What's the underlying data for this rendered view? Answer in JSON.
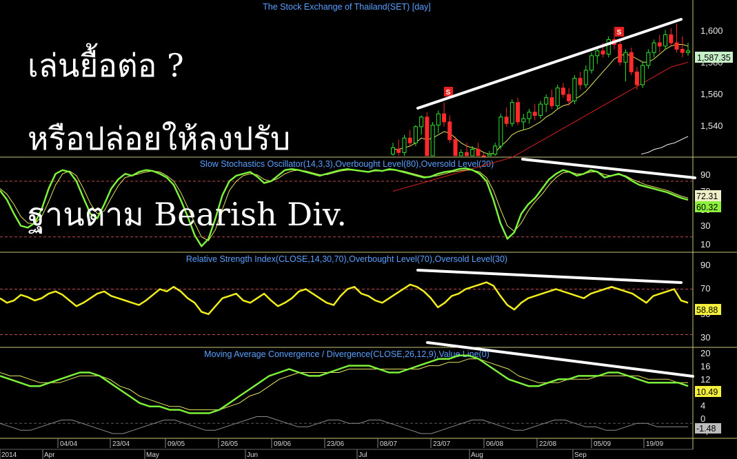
{
  "overlay": {
    "line1": "เล่นยื้อต่อ ?",
    "line2": "หรือปล่อยให้ลงปรับ",
    "line3": "ฐานตาม Bearish Div."
  },
  "colors": {
    "background": "#000000",
    "title": "#5aa0ff",
    "stoch_main": "#7df23a",
    "stoch_signal": "#e8e860",
    "rsi": "#f2ee1c",
    "macd": "#7df23a",
    "macd_signal": "#e8e860",
    "value_line": "#8c8c8c",
    "bull_candle": "#2ee82e",
    "bear_candle": "#ff2a2a",
    "ma_fast": "#e8e860",
    "ma_slow": "#e02020",
    "trendline": "#ffffff",
    "ref_line": "#c24a4a",
    "frame": "#c8c878"
  },
  "chart_data": [
    {
      "type": "candlestick",
      "title": "The Stock Exchange of Thailand(SET) [day]",
      "ylim": [
        1522,
        1610
      ],
      "yticks": [
        "1,600",
        "1,580",
        "1,560",
        "1,540"
      ],
      "last_value_label": "1,587.35",
      "signal_markers": [
        {
          "label": "S",
          "near": "2014-07-22"
        },
        {
          "label": "S",
          "near": "2014-09-08"
        }
      ],
      "candles": [
        {
          "o": 1523,
          "h": 1530,
          "l": 1520,
          "c": 1527
        },
        {
          "o": 1526,
          "h": 1532,
          "l": 1522,
          "c": 1524
        },
        {
          "o": 1524,
          "h": 1535,
          "l": 1522,
          "c": 1533
        },
        {
          "o": 1533,
          "h": 1538,
          "l": 1528,
          "c": 1530
        },
        {
          "o": 1530,
          "h": 1541,
          "l": 1528,
          "c": 1540
        },
        {
          "o": 1540,
          "h": 1547,
          "l": 1535,
          "c": 1546
        },
        {
          "o": 1546,
          "h": 1549,
          "l": 1520,
          "c": 1521
        },
        {
          "o": 1522,
          "h": 1543,
          "l": 1520,
          "c": 1541
        },
        {
          "o": 1541,
          "h": 1550,
          "l": 1536,
          "c": 1548
        },
        {
          "o": 1548,
          "h": 1555,
          "l": 1540,
          "c": 1543
        },
        {
          "o": 1543,
          "h": 1547,
          "l": 1530,
          "c": 1532
        },
        {
          "o": 1532,
          "h": 1534,
          "l": 1518,
          "c": 1520
        },
        {
          "o": 1520,
          "h": 1526,
          "l": 1515,
          "c": 1524
        },
        {
          "o": 1524,
          "h": 1530,
          "l": 1518,
          "c": 1521
        },
        {
          "o": 1521,
          "h": 1528,
          "l": 1517,
          "c": 1526
        },
        {
          "o": 1526,
          "h": 1530,
          "l": 1520,
          "c": 1522
        },
        {
          "o": 1522,
          "h": 1524,
          "l": 1514,
          "c": 1516
        },
        {
          "o": 1516,
          "h": 1525,
          "l": 1512,
          "c": 1523
        },
        {
          "o": 1523,
          "h": 1530,
          "l": 1518,
          "c": 1528
        },
        {
          "o": 1528,
          "h": 1548,
          "l": 1526,
          "c": 1546
        },
        {
          "o": 1546,
          "h": 1552,
          "l": 1540,
          "c": 1542
        },
        {
          "o": 1542,
          "h": 1557,
          "l": 1540,
          "c": 1555
        },
        {
          "o": 1555,
          "h": 1558,
          "l": 1541,
          "c": 1543
        },
        {
          "o": 1543,
          "h": 1548,
          "l": 1538,
          "c": 1545
        },
        {
          "o": 1545,
          "h": 1551,
          "l": 1542,
          "c": 1549
        },
        {
          "o": 1549,
          "h": 1554,
          "l": 1544,
          "c": 1547
        },
        {
          "o": 1547,
          "h": 1556,
          "l": 1545,
          "c": 1554
        },
        {
          "o": 1554,
          "h": 1560,
          "l": 1549,
          "c": 1558
        },
        {
          "o": 1558,
          "h": 1563,
          "l": 1551,
          "c": 1553
        },
        {
          "o": 1553,
          "h": 1566,
          "l": 1551,
          "c": 1564
        },
        {
          "o": 1564,
          "h": 1567,
          "l": 1558,
          "c": 1560
        },
        {
          "o": 1560,
          "h": 1564,
          "l": 1553,
          "c": 1556
        },
        {
          "o": 1556,
          "h": 1572,
          "l": 1554,
          "c": 1570
        },
        {
          "o": 1570,
          "h": 1574,
          "l": 1563,
          "c": 1566
        },
        {
          "o": 1566,
          "h": 1578,
          "l": 1564,
          "c": 1575
        },
        {
          "o": 1575,
          "h": 1586,
          "l": 1573,
          "c": 1584
        },
        {
          "o": 1584,
          "h": 1590,
          "l": 1579,
          "c": 1587
        },
        {
          "o": 1587,
          "h": 1592,
          "l": 1583,
          "c": 1585
        },
        {
          "o": 1585,
          "h": 1596,
          "l": 1583,
          "c": 1594
        },
        {
          "o": 1594,
          "h": 1602,
          "l": 1588,
          "c": 1591
        },
        {
          "o": 1591,
          "h": 1594,
          "l": 1578,
          "c": 1580
        },
        {
          "o": 1580,
          "h": 1588,
          "l": 1568,
          "c": 1586
        },
        {
          "o": 1586,
          "h": 1589,
          "l": 1572,
          "c": 1574
        },
        {
          "o": 1574,
          "h": 1577,
          "l": 1563,
          "c": 1566
        },
        {
          "o": 1566,
          "h": 1580,
          "l": 1564,
          "c": 1578
        },
        {
          "o": 1578,
          "h": 1588,
          "l": 1576,
          "c": 1586
        },
        {
          "o": 1586,
          "h": 1594,
          "l": 1583,
          "c": 1592
        },
        {
          "o": 1592,
          "h": 1597,
          "l": 1586,
          "c": 1590
        },
        {
          "o": 1590,
          "h": 1600,
          "l": 1588,
          "c": 1597
        },
        {
          "o": 1597,
          "h": 1601,
          "l": 1590,
          "c": 1592
        },
        {
          "o": 1592,
          "h": 1604,
          "l": 1586,
          "c": 1588
        },
        {
          "o": 1588,
          "h": 1596,
          "l": 1583,
          "c": 1586
        },
        {
          "o": 1586,
          "h": 1592,
          "l": 1584,
          "c": 1587
        }
      ],
      "ma_fast": [
        1526,
        1526,
        1527,
        1528,
        1530,
        1533,
        1532,
        1533,
        1535,
        1537,
        1536,
        1533,
        1530,
        1528,
        1527,
        1526,
        1524,
        1523,
        1524,
        1528,
        1531,
        1535,
        1537,
        1538,
        1539,
        1541,
        1543,
        1546,
        1548,
        1551,
        1553,
        1554,
        1557,
        1559,
        1562,
        1566,
        1570,
        1574,
        1578,
        1582,
        1584,
        1585,
        1584,
        1582,
        1580,
        1580,
        1582,
        1585,
        1588,
        1590,
        1591,
        1591,
        1590
      ],
      "ma_slow": [
        1500,
        1501,
        1502,
        1503,
        1504,
        1505,
        1506,
        1507,
        1508,
        1509,
        1510,
        1511,
        1512,
        1513,
        1514,
        1515,
        1516,
        1517,
        1518,
        1519,
        1520,
        1521,
        1523,
        1525,
        1527,
        1529,
        1531,
        1533,
        1535,
        1537,
        1539,
        1541,
        1543,
        1545,
        1547,
        1549,
        1551,
        1553,
        1555,
        1557,
        1559,
        1561,
        1563,
        1565,
        1567,
        1569,
        1571,
        1573,
        1575,
        1577,
        1578,
        1579,
        1580
      ],
      "long_ma": [
        1523,
        1524,
        1526,
        1527,
        1529,
        1530,
        1532,
        1534
      ]
    },
    {
      "type": "line",
      "title": "Slow Stochastics Oscillator(14,3,3),Overbought Level(80),Oversold Level(20)",
      "ylim": [
        5,
        100
      ],
      "yticks": [
        90,
        70,
        50,
        30,
        10
      ],
      "overbought": 80,
      "oversold": 20,
      "last_values": [
        "72.31",
        "60.32"
      ],
      "series": [
        {
          "values": [
            70,
            60,
            45,
            32,
            30,
            35,
            50,
            72,
            88,
            92,
            90,
            80,
            62,
            45,
            40,
            55,
            72,
            82,
            88,
            86,
            90,
            92,
            91,
            88,
            84,
            76,
            60,
            42,
            22,
            10,
            18,
            40,
            65,
            80,
            86,
            88,
            90,
            85,
            78,
            80,
            86,
            92,
            93,
            92,
            90,
            88,
            86,
            88,
            90,
            92,
            93,
            92,
            91,
            90,
            92,
            91,
            93,
            92,
            90,
            88,
            86,
            84,
            85,
            88,
            90,
            91,
            93,
            94,
            92,
            88,
            80,
            60,
            35,
            18,
            25,
            45,
            55,
            62,
            72,
            82,
            88,
            92,
            90,
            86,
            88,
            92,
            90,
            84,
            86,
            88,
            85,
            80,
            76,
            74,
            72,
            70,
            68,
            65,
            62,
            60
          ]
        },
        {
          "values": [
            72,
            66,
            55,
            42,
            35,
            34,
            42,
            58,
            76,
            88,
            91,
            86,
            72,
            56,
            45,
            48,
            62,
            75,
            84,
            86,
            88,
            90,
            91,
            90,
            86,
            80,
            68,
            52,
            35,
            20,
            16,
            28,
            50,
            70,
            80,
            86,
            88,
            87,
            82,
            80,
            83,
            88,
            91,
            92,
            91,
            89,
            87,
            87,
            89,
            91,
            92,
            92,
            91,
            90,
            91,
            91,
            92,
            92,
            91,
            89,
            87,
            85,
            85,
            86,
            88,
            90,
            91,
            92,
            92,
            90,
            84,
            70,
            50,
            32,
            26,
            35,
            48,
            58,
            66,
            76,
            84,
            89,
            90,
            88,
            88,
            90,
            90,
            87,
            86,
            87,
            86,
            82,
            79,
            76,
            74,
            72,
            70,
            67,
            64,
            62
          ]
        }
      ]
    },
    {
      "type": "line",
      "title": "Relative Strength Index(CLOSE,14,30,70),Overbought Level(70),Oversold Level(30)",
      "ylim": [
        20,
        100
      ],
      "yticks": [
        90,
        70,
        50,
        30
      ],
      "overbought": 70,
      "oversold": 30,
      "last_values": [
        "58.88"
      ],
      "series": [
        {
          "values": [
            62,
            58,
            60,
            65,
            63,
            60,
            62,
            66,
            68,
            65,
            60,
            55,
            58,
            62,
            66,
            68,
            64,
            62,
            60,
            58,
            56,
            60,
            65,
            70,
            68,
            72,
            68,
            62,
            58,
            50,
            48,
            55,
            62,
            64,
            66,
            60,
            58,
            62,
            66,
            60,
            55,
            58,
            62,
            68,
            70,
            66,
            62,
            58,
            56,
            64,
            70,
            72,
            66,
            64,
            60,
            58,
            62,
            66,
            70,
            74,
            72,
            68,
            62,
            54,
            58,
            64,
            66,
            70,
            72,
            74,
            76,
            73,
            64,
            56,
            52,
            58,
            62,
            64,
            66,
            68,
            70,
            68,
            66,
            64,
            62,
            66,
            68,
            70,
            72,
            70,
            68,
            66,
            62,
            58,
            64,
            66,
            68,
            70,
            60,
            58
          ]
        }
      ]
    },
    {
      "type": "line",
      "title": "Moving Average Convergence / Divergence(CLOSE,26,12,9),Value Line(0)",
      "ylim": [
        -4,
        22
      ],
      "yticks": [
        20,
        16,
        12,
        8,
        4,
        0,
        -4
      ],
      "last_values": [
        "10.49",
        "-1.48"
      ],
      "series": [
        {
          "values": [
            14,
            13,
            12,
            11,
            11,
            12,
            13,
            14,
            15,
            15,
            14,
            12,
            10,
            8,
            6,
            5,
            5,
            4,
            4,
            3,
            3,
            3,
            4,
            6,
            8,
            10,
            12,
            14,
            15,
            16,
            15,
            14,
            14,
            15,
            16,
            17,
            17,
            17,
            16,
            15,
            15,
            16,
            17,
            18,
            19,
            19,
            20,
            20,
            19,
            17,
            15,
            13,
            12,
            11,
            11,
            12,
            13,
            13,
            14,
            14,
            14,
            15,
            15,
            14,
            13,
            12,
            12,
            12,
            12,
            11
          ]
        },
        {
          "values": [
            15,
            14,
            14,
            13,
            12,
            12,
            12,
            13,
            14,
            14,
            14,
            13,
            11,
            10,
            8,
            7,
            6,
            5,
            5,
            4,
            4,
            4,
            4,
            5,
            6,
            8,
            9,
            11,
            13,
            14,
            15,
            15,
            15,
            15,
            15,
            16,
            16,
            16,
            16,
            16,
            16,
            16,
            16,
            17,
            17,
            18,
            18,
            19,
            19,
            18,
            17,
            16,
            14,
            13,
            12,
            12,
            12,
            13,
            13,
            13,
            14,
            14,
            14,
            14,
            14,
            13,
            13,
            13,
            12,
            12
          ]
        },
        {
          "values": [
            0,
            -1,
            -2,
            -2,
            -1,
            0,
            1,
            1,
            0,
            -1,
            -2,
            -3,
            -3,
            -2,
            -1,
            0,
            1,
            1,
            0,
            -1,
            -2,
            -2,
            -1,
            0,
            1,
            2,
            2,
            1,
            0,
            -1,
            -1,
            0,
            1,
            1,
            0,
            0,
            1,
            1,
            0,
            -1,
            -2,
            -3,
            -3,
            -2,
            -1,
            0,
            1,
            1,
            0,
            -1,
            -2,
            -2,
            -1,
            0,
            1,
            1,
            0,
            -1,
            -1,
            -2,
            -2,
            -1,
            0,
            0,
            -1,
            -1,
            -1,
            -1
          ]
        }
      ]
    },
    {
      "type": "axis",
      "date_ticks": [
        "04/04",
        "23/04",
        "09/05",
        "26/05",
        "09/06",
        "23/06",
        "08/07",
        "23/07",
        "06/08",
        "22/08",
        "05/09",
        "19/09"
      ],
      "month_ticks": [
        "2014",
        "Apr",
        "May",
        "Jun",
        "Jul",
        "Aug",
        "Sep"
      ]
    }
  ]
}
